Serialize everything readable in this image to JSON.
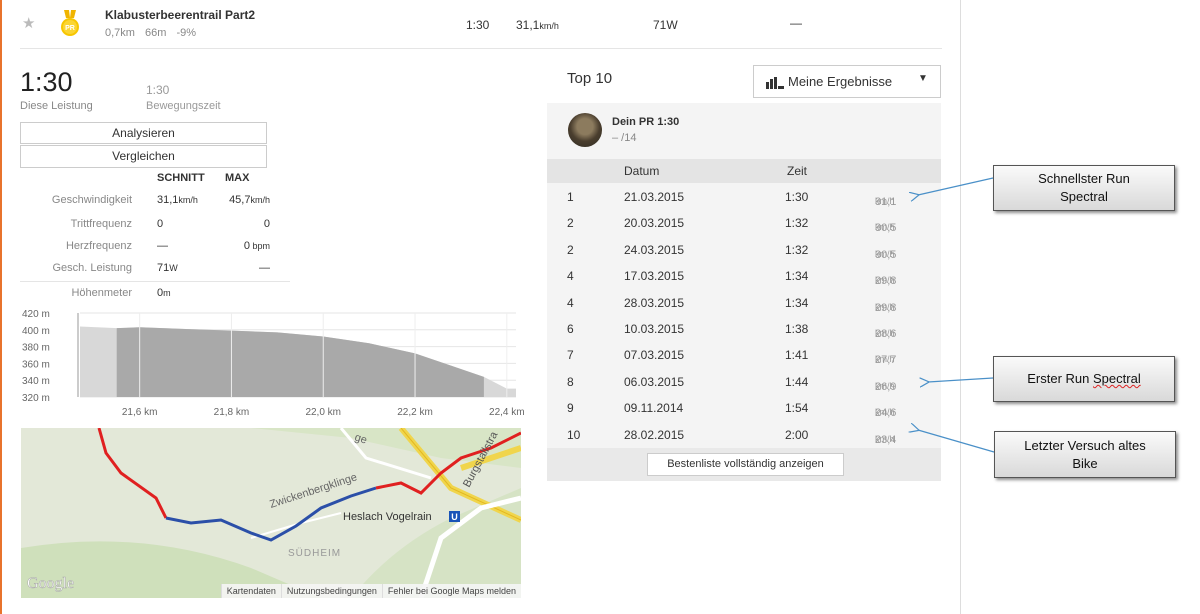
{
  "segment": {
    "name": "Klabusterbeerentrail Part2",
    "distance": "0,7km",
    "elevation": "66m",
    "grade": "-9%",
    "time": "1:30",
    "speed_value": "31,1",
    "speed_unit": "km/h",
    "power": "71W",
    "hr": "—",
    "star_icon": "star-icon",
    "medal_icon": "pr-medal-icon",
    "medal_text": "PR"
  },
  "summary": {
    "time": "1:30",
    "time_label": "Diese Leistung",
    "moving_time": "1:30",
    "moving_label": "Bewegungszeit",
    "analyze_button": "Analysieren",
    "compare_button": "Vergleichen",
    "col_avg": "SCHNITT",
    "col_max": "MAX",
    "stats": [
      {
        "label": "Geschwindigkeit",
        "avg": "31,1",
        "avg_unit": "km/h",
        "max": "45,7",
        "max_unit": "km/h"
      },
      {
        "label": "Trittfrequenz",
        "avg": "0",
        "avg_unit": "",
        "max": "0",
        "max_unit": ""
      },
      {
        "label": "Herzfrequenz",
        "avg": "—",
        "avg_unit": "",
        "max": "0",
        "max_unit": " bpm"
      },
      {
        "label": "Gesch. Leistung",
        "avg": "71",
        "avg_unit": "W",
        "max": "—",
        "max_unit": ""
      },
      {
        "label": "Höhenmeter",
        "avg": "0",
        "avg_unit": "m",
        "max": "",
        "max_unit": ""
      }
    ]
  },
  "elevation_chart": {
    "type": "area",
    "y_ticks": [
      "420 m",
      "400 m",
      "380 m",
      "360 m",
      "340 m",
      "320 m"
    ],
    "x_ticks": [
      "21,6 km",
      "21,8 km",
      "22,0 km",
      "22,2 km",
      "22,4 km"
    ],
    "ylim": [
      320,
      420
    ],
    "xlim": [
      21.47,
      22.42
    ],
    "profile_km": [
      21.47,
      21.55,
      21.6,
      21.7,
      21.8,
      21.9,
      22.0,
      22.1,
      22.2,
      22.28,
      22.35,
      22.4,
      22.42
    ],
    "profile_m": [
      404,
      402,
      403,
      401,
      399,
      397,
      392,
      384,
      372,
      357,
      344,
      330,
      330
    ],
    "highlight_range_km": [
      21.55,
      22.35
    ],
    "colors": {
      "highlight": "#a9a9a9",
      "context": "#d8d8d8"
    }
  },
  "map": {
    "labels": {
      "street1": "Zwickenbergklinge",
      "street2": "Burgstallstra",
      "station": "Heslach Vogelrain",
      "station_icon": "U",
      "district": "SÜDHEIM",
      "ge": "ge",
      "logo": "Google"
    },
    "footer": [
      "Kartendaten",
      "Nutzungsbedingungen",
      "Fehler bei Google Maps melden"
    ]
  },
  "leaderboard": {
    "title": "Top 10",
    "dropdown_label": "Meine Ergebnisse",
    "pr_label": "Dein PR 1:30",
    "pr_rank": "– /14",
    "columns": {
      "date": "Datum",
      "time": "Zeit"
    },
    "rows": [
      {
        "rank": "1",
        "date": "21.03.2015",
        "time": "1:30",
        "speed": "31,1"
      },
      {
        "rank": "2",
        "date": "20.03.2015",
        "time": "1:32",
        "speed": "30,5"
      },
      {
        "rank": "2",
        "date": "24.03.2015",
        "time": "1:32",
        "speed": "30,5"
      },
      {
        "rank": "4",
        "date": "17.03.2015",
        "time": "1:34",
        "speed": "29,8"
      },
      {
        "rank": "4",
        "date": "28.03.2015",
        "time": "1:34",
        "speed": "29,8"
      },
      {
        "rank": "6",
        "date": "10.03.2015",
        "time": "1:38",
        "speed": "28,6"
      },
      {
        "rank": "7",
        "date": "07.03.2015",
        "time": "1:41",
        "speed": "27,7"
      },
      {
        "rank": "8",
        "date": "06.03.2015",
        "time": "1:44",
        "speed": "26,9"
      },
      {
        "rank": "9",
        "date": "09.11.2014",
        "time": "1:54",
        "speed": "24,6"
      },
      {
        "rank": "10",
        "date": "28.02.2015",
        "time": "2:00",
        "speed": "23,4"
      }
    ],
    "speed_unit": "km/h",
    "show_all_button": "Bestenliste vollständig anzeigen"
  },
  "annotations": [
    {
      "line1": "Schnellster Run",
      "line2": "Spectral"
    },
    {
      "line1": "Erster Run ",
      "line2": "Spectral"
    },
    {
      "line1": "Letzter Versuch altes",
      "line2": "Bike"
    }
  ],
  "colors": {
    "accent": "#e8732c",
    "medal": "#f3c400",
    "route_red": "#e02020",
    "route_blue": "#2b4fa8",
    "arrow": "#4a90c8"
  }
}
